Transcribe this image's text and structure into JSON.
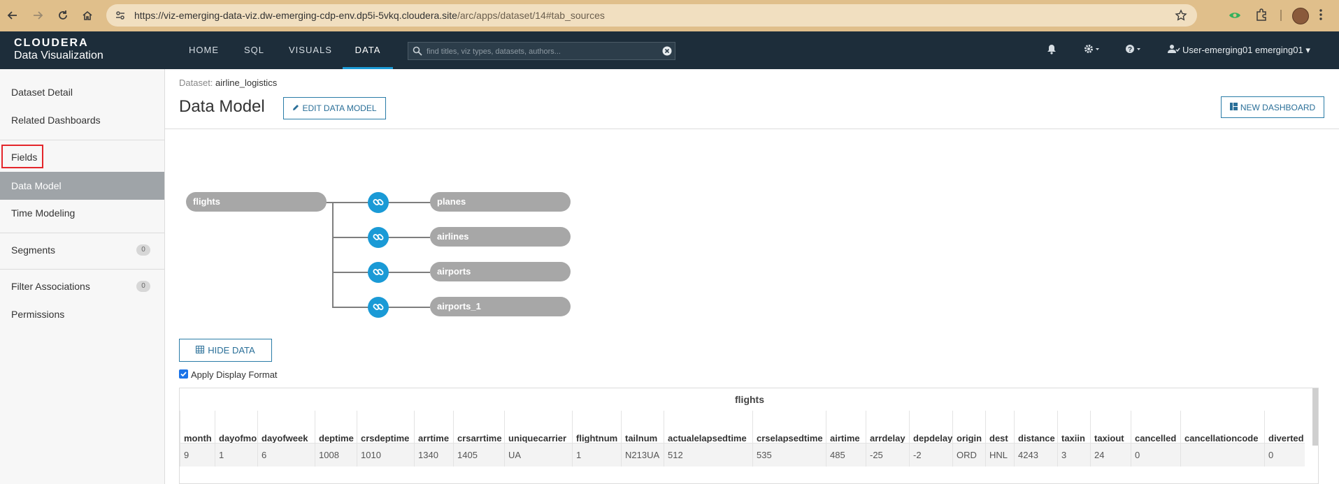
{
  "browser": {
    "url_main": "https://viz-emerging-data-viz.dw-emerging-cdp-env.dp5i-5vkq.cloudera.site",
    "url_path": "/arc/apps/dataset/14#tab_sources"
  },
  "app": {
    "brand_line1": "CLOUDERA",
    "brand_line2": "Data Visualization",
    "nav": [
      "HOME",
      "SQL",
      "VISUALS",
      "DATA"
    ],
    "active_nav": "DATA",
    "search_placeholder": "find titles, viz types, datasets, authors...",
    "user": "User-emerging01 emerging01"
  },
  "sidebar": {
    "items": [
      {
        "label": "Dataset Detail"
      },
      {
        "label": "Related Dashboards"
      },
      {
        "label": "Fields"
      },
      {
        "label": "Data Model"
      },
      {
        "label": "Time Modeling"
      },
      {
        "label": "Segments",
        "badge": "0"
      },
      {
        "label": "Filter Associations",
        "badge": "0"
      },
      {
        "label": "Permissions"
      }
    ]
  },
  "main": {
    "breadcrumb_prefix": "Dataset:",
    "dataset_name": "airline_logistics",
    "title": "Data Model",
    "edit_button": "EDIT DATA MODEL",
    "new_dashboard_button": "NEW DASHBOARD",
    "hide_data_button": "HIDE DATA",
    "apply_display_format": "Apply Display Format"
  },
  "model": {
    "root": "flights",
    "joins": [
      "planes",
      "airlines",
      "airports",
      "airports_1"
    ]
  },
  "table": {
    "title": "flights",
    "columns": [
      "month",
      "dayofmonth",
      "dayofweek",
      "deptime",
      "crsdeptime",
      "arrtime",
      "crsarrtime",
      "uniquecarrier",
      "flightnum",
      "tailnum",
      "actualelapsedtime",
      "crselapsedtime",
      "airtime",
      "arrdelay",
      "depdelay",
      "origin",
      "dest",
      "distance",
      "taxiin",
      "taxiout",
      "cancelled",
      "cancellationcode",
      "diverted"
    ],
    "rows": [
      [
        "9",
        "1",
        "6",
        "1008",
        "1010",
        "1340",
        "1405",
        "UA",
        "1",
        "N213UA",
        "512",
        "535",
        "485",
        "-25",
        "-2",
        "ORD",
        "HNL",
        "4243",
        "3",
        "24",
        "0",
        "",
        "0"
      ]
    ]
  },
  "colors": {
    "header_bg": "#1d2d3a",
    "accent": "#1a9ad6",
    "sidebar_active": "#9fa4a8",
    "highlight_box": "#e4262b"
  }
}
